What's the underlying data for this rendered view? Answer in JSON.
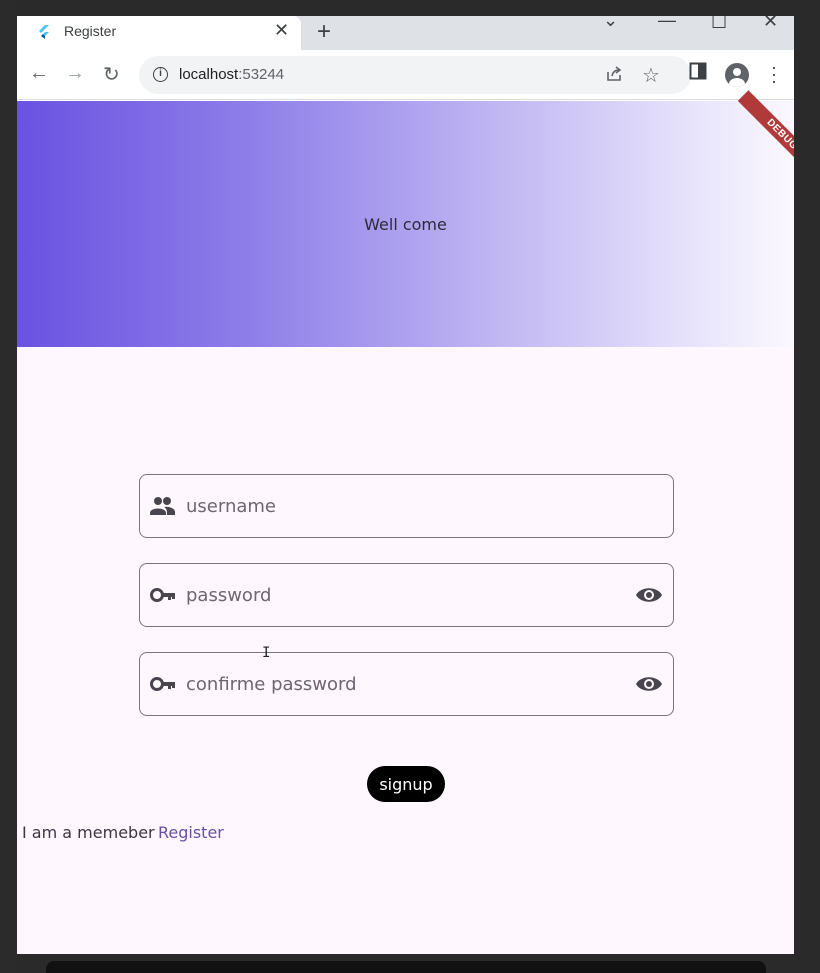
{
  "browser": {
    "tab_title": "Register",
    "new_tab_label": "+",
    "url_host": "localhost",
    "url_port": ":53244"
  },
  "app": {
    "banner_text": "Well come",
    "debug_label": "DEBUG",
    "fields": {
      "username_placeholder": "username",
      "password_placeholder": "password",
      "confirm_placeholder": "confirme password"
    },
    "signup_label": "signup",
    "member_text": "I am a memeber",
    "register_link": "Register"
  },
  "colors": {
    "accent": "#6750a4",
    "gradient_start": "#6a52e2",
    "page_bg": "#fef7fe"
  }
}
